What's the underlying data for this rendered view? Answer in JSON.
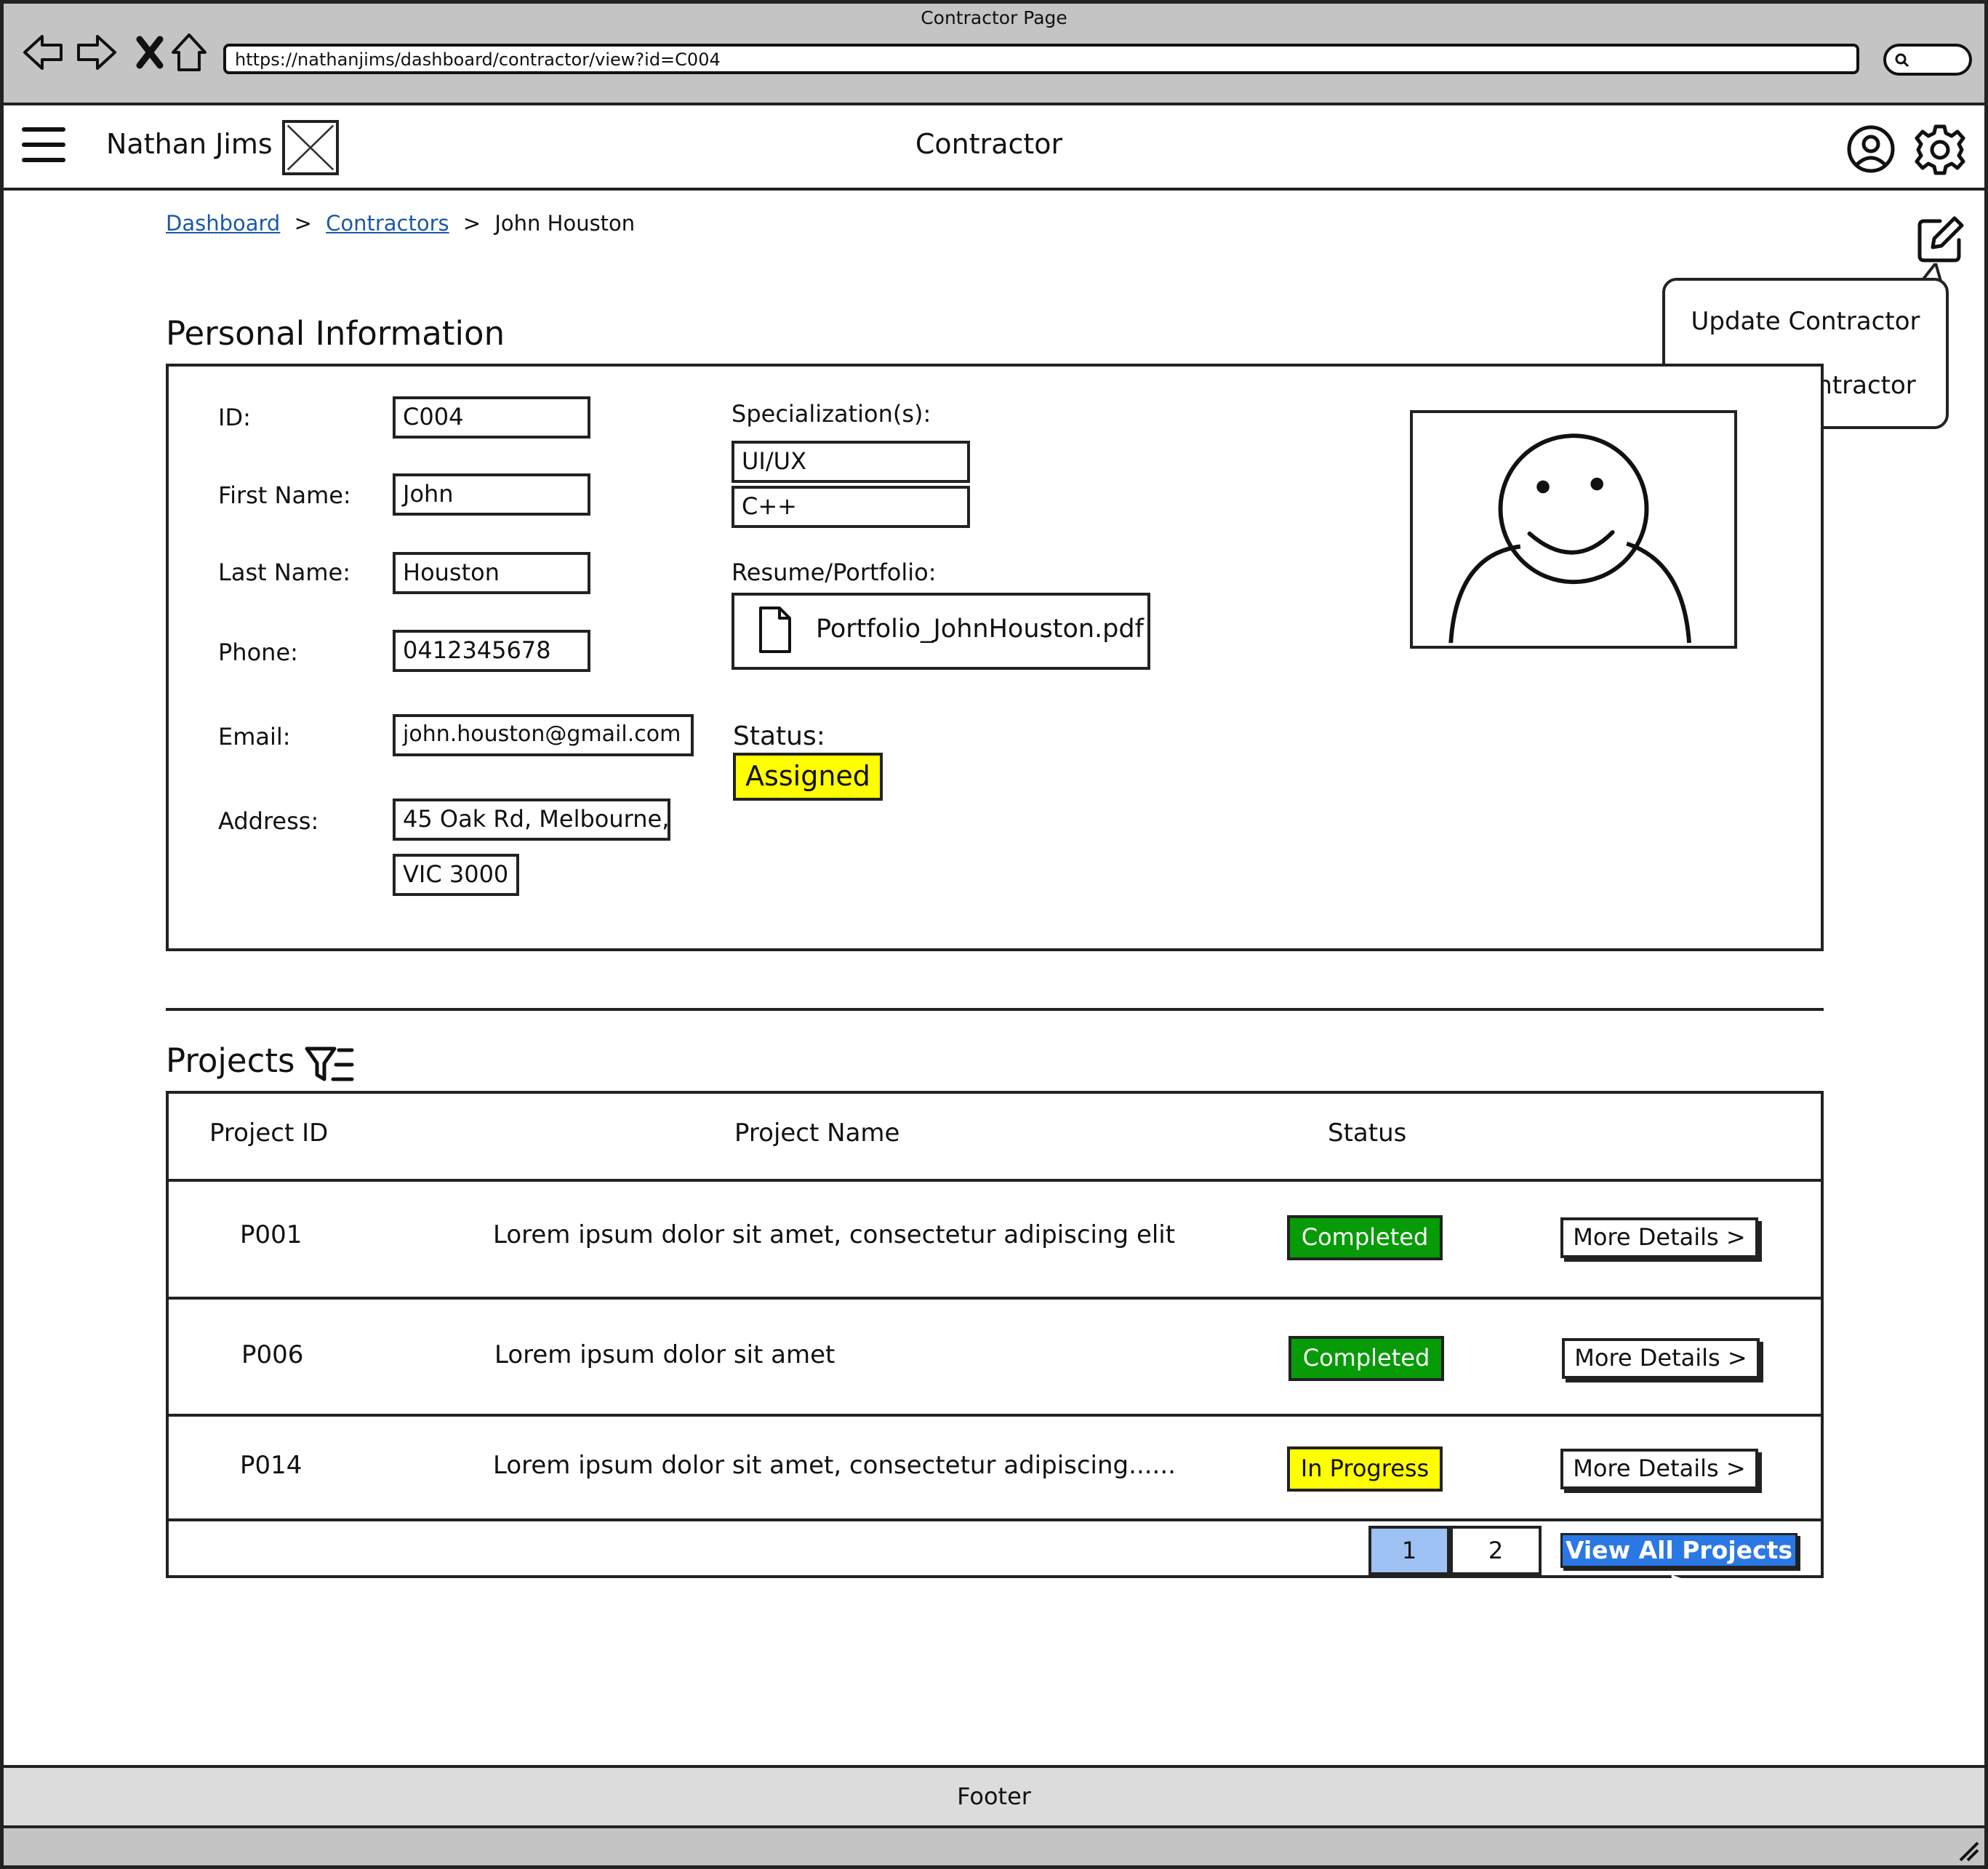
{
  "window": {
    "title": "Contractor Page",
    "url": "https://nathanjims/dashboard/contractor/view?id=C004"
  },
  "header": {
    "brand": "Nathan Jims",
    "title": "Contractor"
  },
  "breadcrumb": {
    "items": [
      "Dashboard",
      "Contractors"
    ],
    "current": "John Houston",
    "separator": ">"
  },
  "actions_menu": {
    "update": "Update Contractor",
    "delete": "Delete Contractor"
  },
  "personal": {
    "section_title": "Personal Information",
    "labels": {
      "id": "ID:",
      "first_name": "First Name:",
      "last_name": "Last Name:",
      "phone": "Phone:",
      "email": "Email:",
      "address": "Address:",
      "specializations": "Specialization(s):",
      "resume": "Resume/Portfolio:",
      "status": "Status:"
    },
    "values": {
      "id": "C004",
      "first_name": "John",
      "last_name": "Houston",
      "phone": "0412345678",
      "email": "john.houston@gmail.com",
      "address_line1": "45 Oak Rd, Melbourne,",
      "address_line2": "VIC 3000",
      "specializations": [
        "UI/UX",
        "C++"
      ],
      "resume_file": "Portfolio_JohnHouston.pdf",
      "status": "Assigned"
    }
  },
  "projects": {
    "section_title": "Projects",
    "columns": [
      "Project ID",
      "Project Name",
      "Status"
    ],
    "rows": [
      {
        "id": "P001",
        "name": "Lorem ipsum dolor sit amet, consectetur adipiscing elit",
        "status": "Completed",
        "action": "More Details >"
      },
      {
        "id": "P006",
        "name": "Lorem ipsum dolor sit amet",
        "status": "Completed",
        "action": "More Details >"
      },
      {
        "id": "P014",
        "name": "Lorem ipsum dolor sit amet, consectetur adipiscing......",
        "status": "In Progress",
        "action": "More Details >"
      }
    ],
    "pagination": {
      "pages": [
        "1",
        "2"
      ],
      "current": "1"
    },
    "view_all": "View All Projects >"
  },
  "footer": {
    "label": "Footer"
  },
  "colors": {
    "completed": "#079b08",
    "in_progress": "#ffff00",
    "assigned": "#ffff00",
    "link": "#1a5aa8",
    "primary_button": "#2b78e4",
    "page_active": "#9dc1f2"
  }
}
